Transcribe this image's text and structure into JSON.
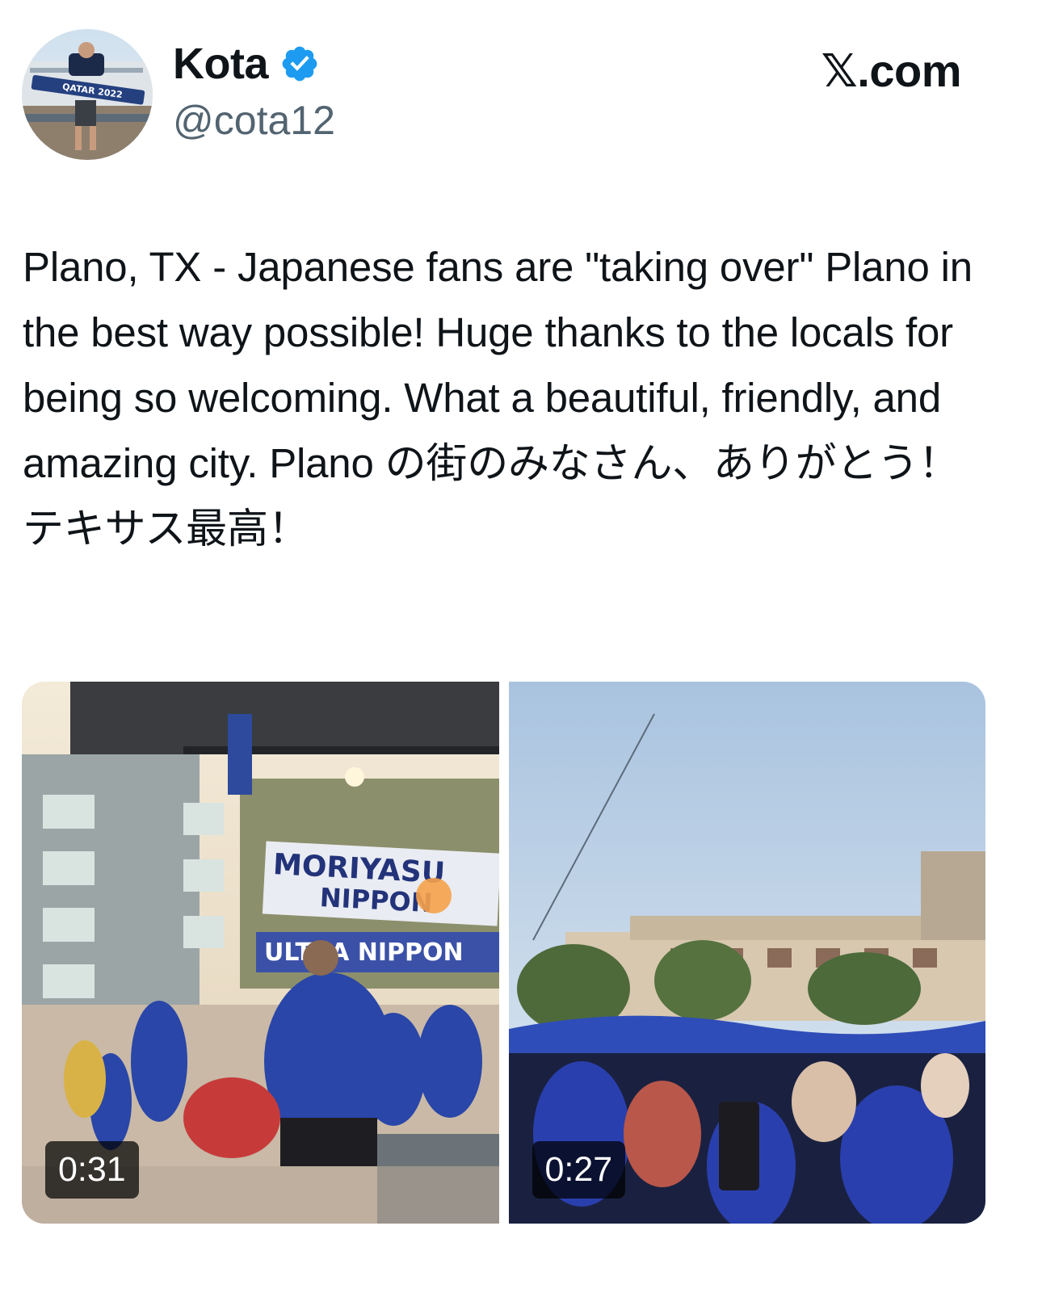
{
  "author": {
    "display_name": "Kota",
    "handle": "@cota12",
    "verified": true,
    "avatar_banner_text": "QATAR 2022"
  },
  "brand": {
    "label": "𝕏.com"
  },
  "tweet": {
    "text": "Plano, TX - Japanese fans are \"taking over\" Plano in the best way possible! Huge thanks to the locals for being so welcoming. What a beautiful, friendly, and amazing city. Plano の街のみなさん、ありがとう！テキサス最高！"
  },
  "media": [
    {
      "duration": "0:31",
      "banner_top": "MORIYASU",
      "banner_bottom": "NIPPON",
      "banner_second": "ULTRA NIPPON"
    },
    {
      "duration": "0:27"
    }
  ],
  "colors": {
    "verified_blue": "#1d9bf0",
    "handle_gray": "#536471",
    "text": "#0f1419"
  }
}
